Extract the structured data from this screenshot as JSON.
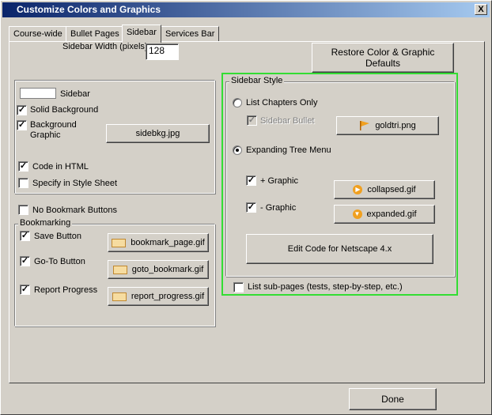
{
  "window": {
    "title": "Customize Colors and Graphics",
    "close_glyph": "X"
  },
  "tabs": [
    {
      "label": "Course-wide"
    },
    {
      "label": "Bullet Pages"
    },
    {
      "label": "Sidebar"
    },
    {
      "label": "Services Bar"
    }
  ],
  "sidebar_width": {
    "label": "Sidebar Width (pixels)",
    "value": "128"
  },
  "restore_button": "Restore Color & Graphic Defaults",
  "appearance": {
    "sidebar_label": "Sidebar",
    "solid_background": {
      "label": "Solid Background",
      "checked": true
    },
    "background_graphic": {
      "label_line1": "Background",
      "label_line2": "Graphic",
      "checked": true,
      "file": "sidebkg.jpg"
    },
    "code_in_html": {
      "label": "Code in HTML",
      "checked": true
    },
    "specify_in_style_sheet": {
      "label": "Specify in Style Sheet",
      "checked": false
    }
  },
  "no_bookmark_buttons": {
    "label": "No Bookmark Buttons",
    "checked": false
  },
  "bookmarking": {
    "title": "Bookmarking",
    "save_button": {
      "label": "Save Button",
      "checked": true,
      "file": "bookmark_page.gif"
    },
    "goto_button": {
      "label": "Go-To Button",
      "checked": true,
      "file": "goto_bookmark.gif"
    },
    "report_progress": {
      "label": "Report Progress",
      "checked": true,
      "file": "report_progress.gif"
    }
  },
  "sidebar_style": {
    "title": "Sidebar Style",
    "list_chapters_only": {
      "label": "List Chapters Only",
      "selected": false
    },
    "sidebar_bullet": {
      "label": "Sidebar Bullet",
      "checked": true,
      "file": "goldtri.png"
    },
    "expanding_tree_menu": {
      "label": "Expanding Tree Menu",
      "selected": true
    },
    "plus_graphic": {
      "label": "+ Graphic",
      "checked": true,
      "file": "collapsed.gif"
    },
    "minus_graphic": {
      "label": "- Graphic",
      "checked": true,
      "file": "expanded.gif"
    },
    "edit_code_button": "Edit Code for Netscape 4.x",
    "list_sub_pages": {
      "label": "List sub-pages (tests, step-by-step, etc.)",
      "checked": false
    }
  },
  "done_button": "Done",
  "check_glyph": "✓",
  "colors": {
    "highlight": "#33dd33",
    "titlebar_start": "#0a246a",
    "titlebar_end": "#a6caf0"
  }
}
